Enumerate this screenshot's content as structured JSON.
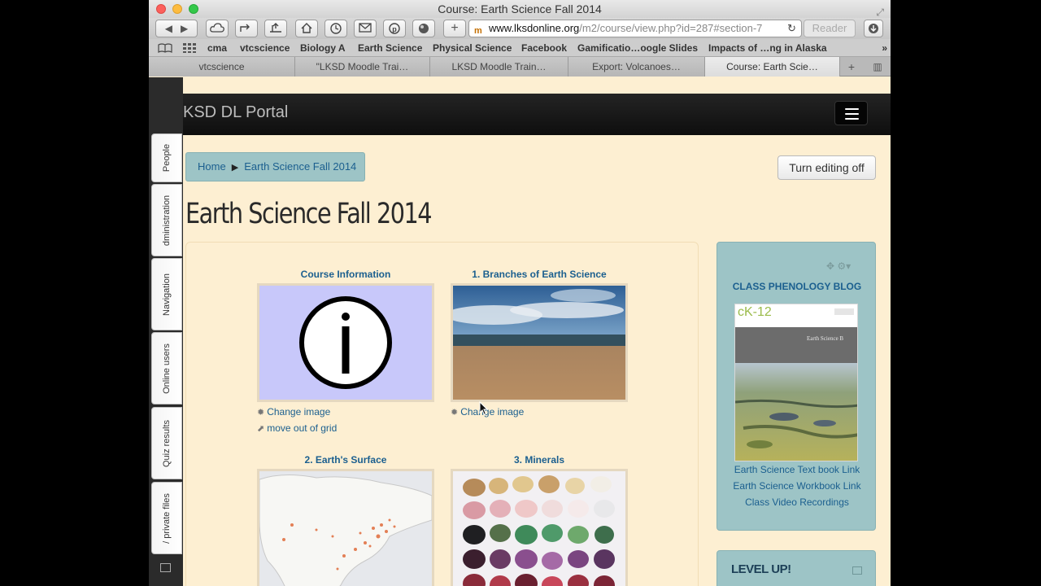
{
  "window": {
    "title": "Course: Earth Science Fall 2014"
  },
  "toolbar": {
    "url_domain": "www.lksdonline.org",
    "url_path": "/m2/course/view.php?id=287#section-7",
    "reader_label": "Reader"
  },
  "bookmarks": [
    "cma",
    "vtcscience",
    "Biology A",
    "Earth Science",
    "Physical Science",
    "Facebook",
    "Gamificatio…oogle Slides",
    "Impacts of …ng in Alaska"
  ],
  "tabs": [
    {
      "label": "vtcscience"
    },
    {
      "label": "\"LKSD Moodle Trai…"
    },
    {
      "label": "LKSD Moodle Train…"
    },
    {
      "label": "Export: Volcanoes…"
    },
    {
      "label": "Course: Earth Scie…"
    }
  ],
  "navbar": {
    "brand": "KSD DL Portal"
  },
  "side_tabs": [
    "People",
    "dministration",
    "Navigation",
    "Online users",
    "Quiz results",
    "/ private files"
  ],
  "breadcrumb": {
    "home": "Home",
    "course": "Earth Science Fall 2014"
  },
  "edit_button": "Turn editing off",
  "page_title": "Earth Science Fall 2014",
  "grid": [
    {
      "title": "Course Information",
      "change_image": "Change image",
      "move_out": "move out of grid"
    },
    {
      "title": "1. Branches of Earth Science",
      "change_image": "Change image"
    },
    {
      "title": "2. Earth's Surface"
    },
    {
      "title": "3. Minerals"
    }
  ],
  "side_block": {
    "title": "CLASS PHENOLOGY BLOG",
    "book_brand": "cK-12",
    "book_title": "Earth Science B",
    "links": [
      "Earth Science Text book Link",
      "Earth Science Workbook Link",
      "Class Video Recordings"
    ]
  },
  "level_block": {
    "title": "LEVEL UP!"
  }
}
